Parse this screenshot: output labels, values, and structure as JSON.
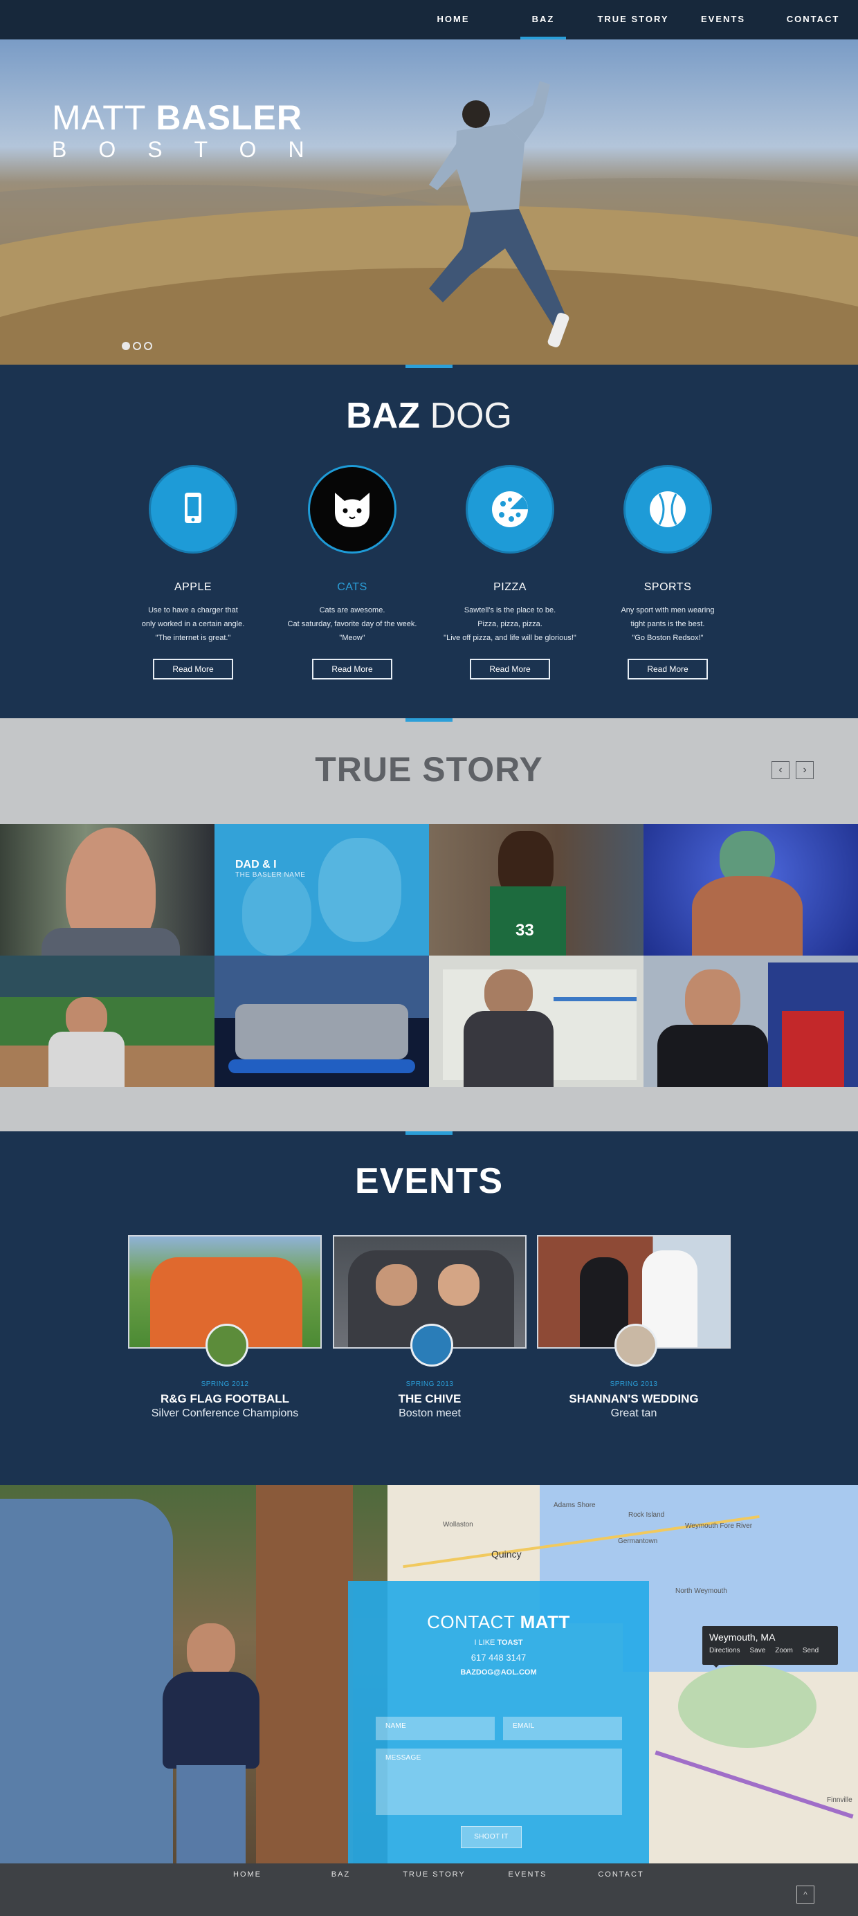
{
  "nav": {
    "items": [
      {
        "label": "HOME"
      },
      {
        "label": "BAZ"
      },
      {
        "label": "TRUE STORY"
      },
      {
        "label": "EVENTS"
      },
      {
        "label": "CONTACT"
      }
    ],
    "active": "BAZ"
  },
  "hero": {
    "title_light": "MATT",
    "title_bold": "BASLER",
    "subtitle": "BOSTON",
    "slides": 3,
    "current_slide": 1
  },
  "baz": {
    "title_bold": "BAZ",
    "title_light": "DOG",
    "features": [
      {
        "icon": "phone-icon",
        "name": "APPLE",
        "desc": [
          "Use to have a charger that",
          "only worked in a certain angle.",
          "\"The internet is great.\""
        ],
        "button": "Read More"
      },
      {
        "icon": "cat-icon",
        "name": "CATS",
        "desc": [
          "Cats are awesome.",
          "Cat saturday, favorite day of the week.",
          "\"Meow\""
        ],
        "button": "Read More"
      },
      {
        "icon": "pizza-icon",
        "name": "PIZZA",
        "desc": [
          "Sawtell's is the place to be.",
          "Pizza, pizza, pizza.",
          "\"Live off pizza, and life will be glorious!\""
        ],
        "button": "Read More"
      },
      {
        "icon": "baseball-icon",
        "name": "SPORTS",
        "desc": [
          "Any sport with men wearing",
          "tight pants is the best.",
          "\"Go Boston Redsox!\""
        ],
        "button": "Read More"
      }
    ]
  },
  "story": {
    "title": "TRUE STORY",
    "prev": "‹",
    "next": "›",
    "featured_tile": {
      "title": "DAD & I",
      "subtitle": "THE BASLER NAME"
    },
    "jersey_text": "33"
  },
  "events": {
    "title": "EVENTS",
    "items": [
      {
        "date": "SPRING 2012",
        "name": "R&G FLAG FOOTBALL",
        "sub": "Silver Conference Champions"
      },
      {
        "date": "SPRING 2013",
        "name": "THE CHIVE",
        "sub": "Boston meet"
      },
      {
        "date": "SPRING 2013",
        "name": "SHANNAN'S WEDDING",
        "sub": "Great tan"
      }
    ]
  },
  "contact": {
    "title_light": "CONTACT",
    "title_bold": "MATT",
    "like_prefix": "I LIKE",
    "like": "TOAST",
    "phone": "617 448 3147",
    "email": "BAZDOG@AOL.COM",
    "name_ph": "NAME",
    "email_ph": "EMAIL",
    "message_ph": "MESSAGE",
    "submit": "SHOOT IT"
  },
  "map": {
    "popup_title": "Weymouth, MA",
    "popup_actions": [
      "Directions",
      "Save",
      "Zoom",
      "Send"
    ],
    "labels": [
      "Quincy",
      "Adams Shore",
      "Rock Island",
      "Germantown",
      "North Weymouth",
      "Wollaston",
      "Weymouth Fore River",
      "Finnville"
    ]
  },
  "footer": {
    "items": [
      "HOME",
      "BAZ",
      "TRUE STORY",
      "EVENTS",
      "CONTACT"
    ],
    "to_top": "^"
  },
  "colors": {
    "accent": "#2b9fd9",
    "navy": "#1b3350",
    "gray": "#c4c6c8",
    "footer": "#3e4145"
  }
}
